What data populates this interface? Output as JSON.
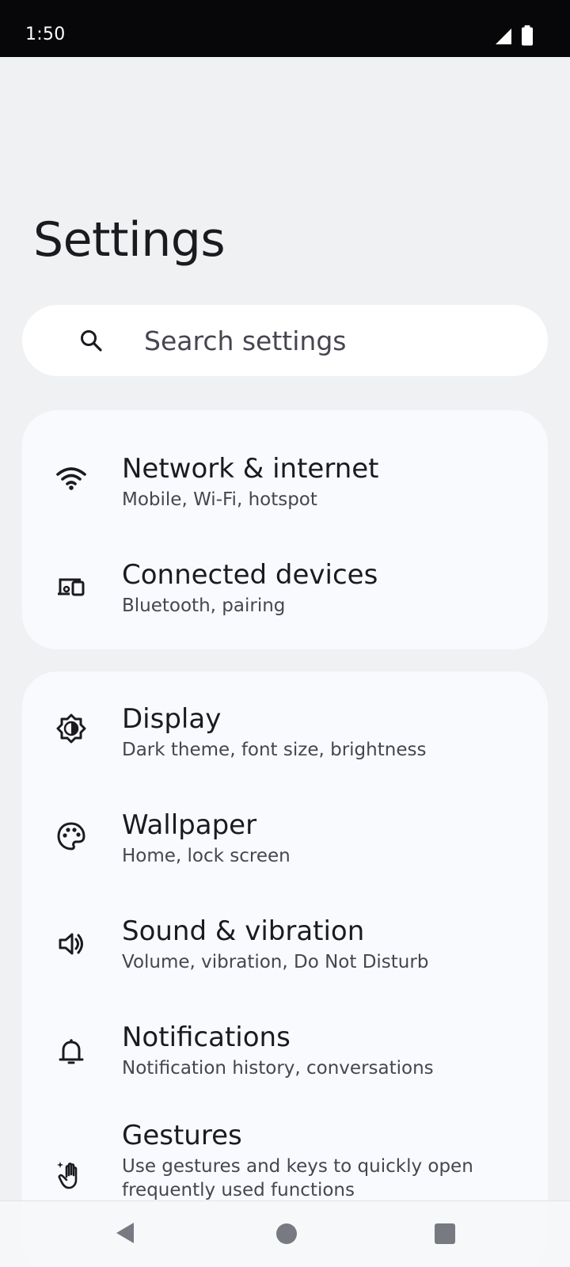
{
  "status_bar": {
    "time": "1:50",
    "icons": [
      "signal-icon",
      "battery-icon"
    ]
  },
  "page": {
    "title": "Settings"
  },
  "search": {
    "placeholder": "Search settings"
  },
  "sections": [
    {
      "items": [
        {
          "title": "Network & internet",
          "subtitle": "Mobile, Wi-Fi, hotspot",
          "icon": "wifi-icon"
        },
        {
          "title": "Connected devices",
          "subtitle": "Bluetooth, pairing",
          "icon": "devices-icon"
        }
      ]
    },
    {
      "items": [
        {
          "title": "Display",
          "subtitle": "Dark theme, font size, brightness",
          "icon": "display-brightness-icon"
        },
        {
          "title": "Wallpaper",
          "subtitle": "Home, lock screen",
          "icon": "palette-icon"
        },
        {
          "title": "Sound & vibration",
          "subtitle": "Volume, vibration, Do Not Disturb",
          "icon": "volume-icon"
        },
        {
          "title": "Notifications",
          "subtitle": "Notification history, conversations",
          "icon": "bell-icon"
        },
        {
          "title": "Gestures",
          "subtitle": "Use gestures and keys to quickly open frequently used functions",
          "subtitle_line1": "Use gestures and keys to quickly open",
          "subtitle_line2": "frequently used functions",
          "icon": "hand-gesture-icon"
        }
      ]
    }
  ],
  "nav_bar": {
    "buttons": [
      "back-icon",
      "home-icon",
      "recents-icon"
    ]
  },
  "colors": {
    "background": "#f0f1f3",
    "card": "#f9fafe",
    "status_bar": "#070709",
    "text_primary": "#1b1b1f",
    "text_secondary": "#45464f"
  }
}
